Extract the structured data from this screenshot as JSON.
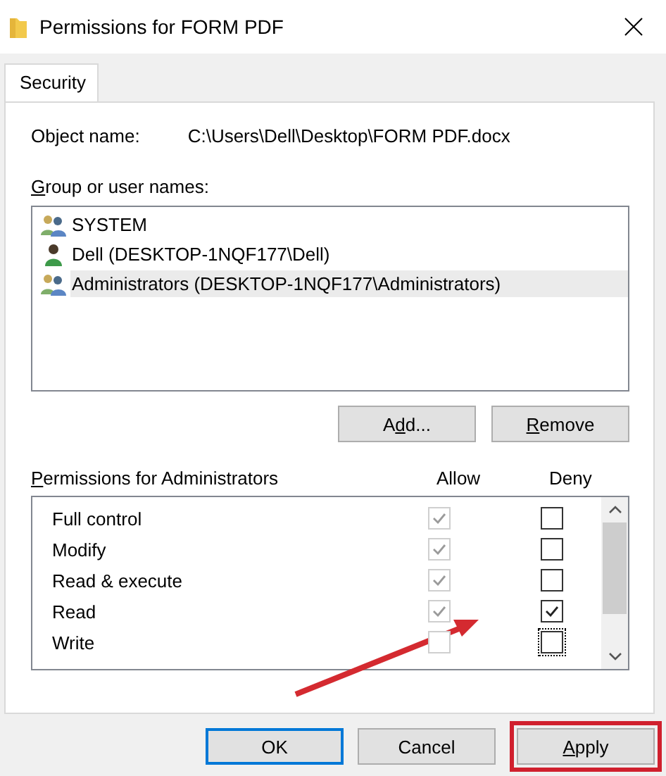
{
  "window": {
    "title": "Permissions for FORM PDF"
  },
  "tabs": [
    {
      "label": "Security",
      "selected": true
    }
  ],
  "object_name": {
    "label": "Object name:",
    "value": "C:\\Users\\Dell\\Desktop\\FORM PDF.docx"
  },
  "group_label": {
    "key": "G",
    "after": "roup or user names:"
  },
  "users": [
    {
      "name": "SYSTEM",
      "kind": "group",
      "selected": false
    },
    {
      "name": "Dell (DESKTOP-1NQF177\\Dell)",
      "kind": "user",
      "selected": false
    },
    {
      "name": "Administrators (DESKTOP-1NQF177\\Administrators)",
      "kind": "group",
      "selected": true
    }
  ],
  "user_buttons": [
    {
      "before": "A",
      "key": "d",
      "after": "d..."
    },
    {
      "key": "R",
      "after": "emove"
    }
  ],
  "permissions_label": {
    "key": "P",
    "after": "ermissions for Administrators"
  },
  "columns": [
    "Allow",
    "Deny"
  ],
  "permissions": [
    {
      "name": "Full control",
      "allow": true,
      "allow_disabled": true,
      "deny": false,
      "focused": false
    },
    {
      "name": "Modify",
      "allow": true,
      "allow_disabled": true,
      "deny": false,
      "focused": false
    },
    {
      "name": "Read & execute",
      "allow": true,
      "allow_disabled": true,
      "deny": false,
      "focused": false
    },
    {
      "name": "Read",
      "allow": true,
      "allow_disabled": true,
      "deny": true,
      "focused": false
    },
    {
      "name": "Write",
      "allow": false,
      "allow_disabled": true,
      "deny": false,
      "focused": true
    }
  ],
  "buttons": [
    {
      "before": "OK",
      "default": true,
      "highlighted": false
    },
    {
      "before": "Cancel",
      "default": false,
      "highlighted": false
    },
    {
      "key": "A",
      "after": "pply",
      "default": false,
      "highlighted": true
    }
  ],
  "annotation_arrow": true
}
